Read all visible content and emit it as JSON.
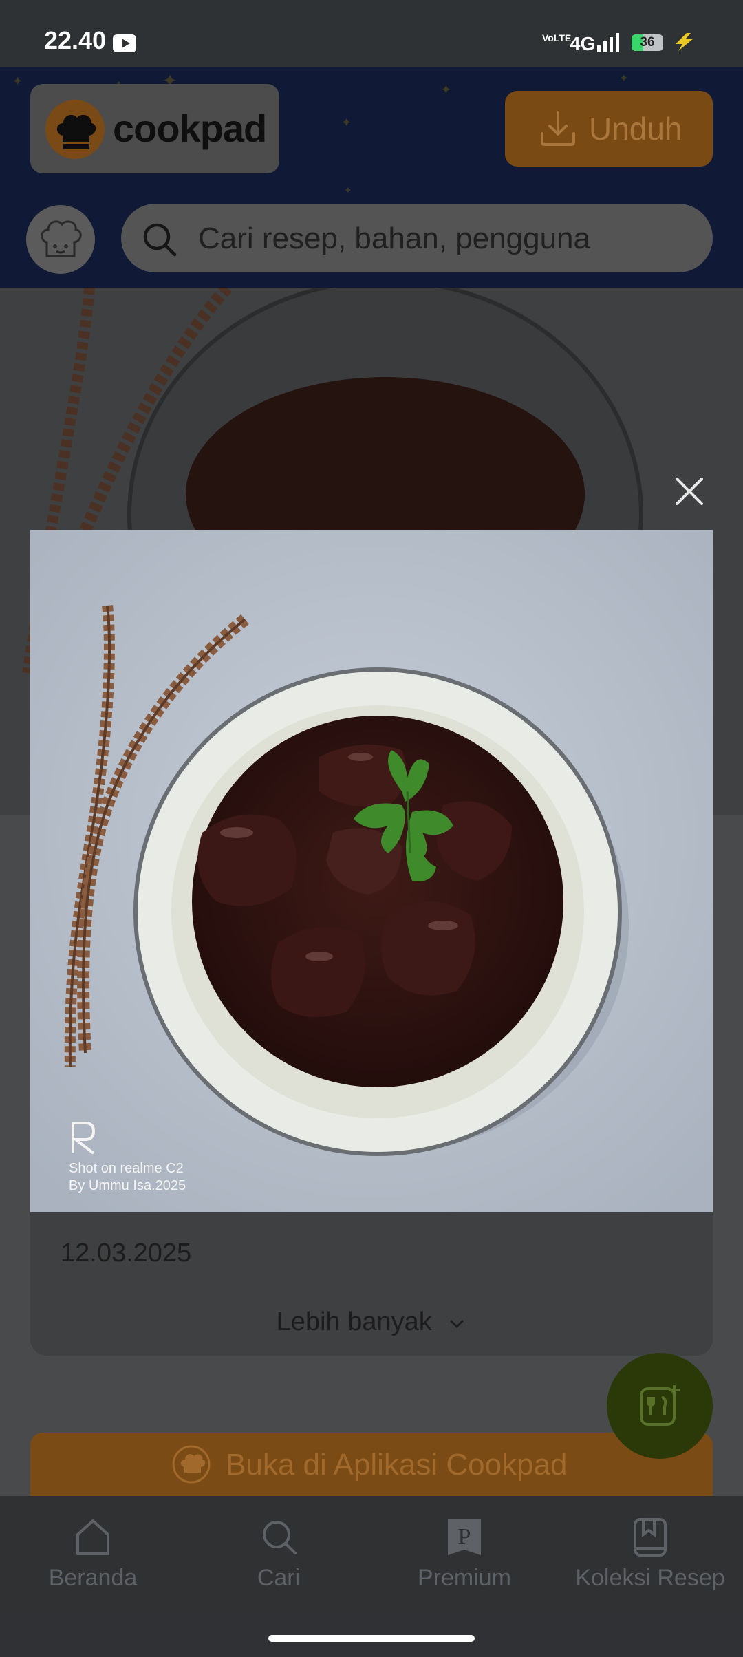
{
  "status_bar": {
    "time": "22.40",
    "network_label": "VoLTE",
    "network_type": "4G",
    "battery_level": "36",
    "battery_fraction": 0.36
  },
  "header": {
    "logo_text": "cookpad",
    "download_label": "Unduh",
    "search_placeholder": "Cari resep, bahan, pengguna"
  },
  "recipe": {
    "date": "12.03.2025",
    "more_label": "Lebih banyak"
  },
  "open_app_label": "Buka di Aplikasi Cookpad",
  "bottom_nav": {
    "items": [
      {
        "label": "Beranda",
        "icon": "home-icon"
      },
      {
        "label": "Cari",
        "icon": "search-icon"
      },
      {
        "label": "Premium",
        "icon": "premium-icon"
      },
      {
        "label": "Koleksi Resep",
        "icon": "bookmark-book-icon"
      }
    ]
  },
  "viewer": {
    "watermark_line1": "Shot on realme C2",
    "watermark_line2": "By Ummu Isa.2025"
  },
  "colors": {
    "brand_orange": "#f7941d",
    "header_navy": "#101a36",
    "fab_green": "#2b3808",
    "battery_green": "#38d66b"
  }
}
